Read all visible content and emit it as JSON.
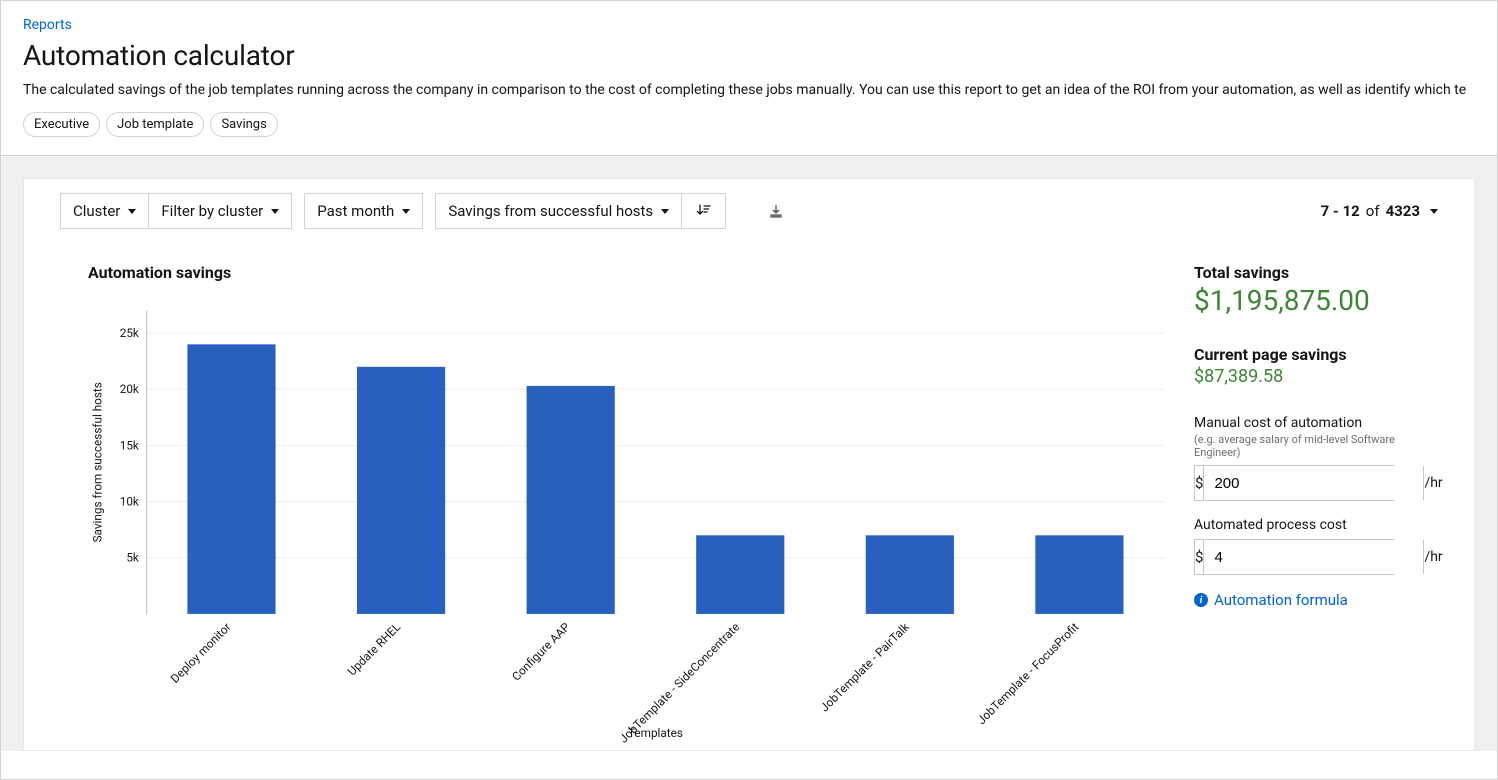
{
  "breadcrumb": {
    "reports": "Reports"
  },
  "page": {
    "title": "Automation calculator",
    "description": "The calculated savings of the job templates running across the company in comparison to the cost of completing these jobs manually. You can use this report to get an idea of the ROI from your automation, as well as identify which te"
  },
  "tags": [
    "Executive",
    "Job template",
    "Savings"
  ],
  "toolbar": {
    "cluster_label": "Cluster",
    "filter_label": "Filter by cluster",
    "date_label": "Past month",
    "metric_label": "Savings from successful hosts",
    "pagination": {
      "range": "7 - 12",
      "of": "of",
      "total": "4323"
    }
  },
  "chart": {
    "title": "Automation savings"
  },
  "sidebar": {
    "total_label": "Total savings",
    "total_value": "$1,195,875.00",
    "page_label": "Current page savings",
    "page_value": "$87,389.58",
    "manual_cost_label": "Manual cost of automation",
    "manual_cost_sublabel": "(e.g. average salary of mid-level Software Engineer)",
    "manual_cost_value": "200",
    "auto_cost_label": "Automated process cost",
    "auto_cost_value": "4",
    "currency": "$",
    "per_hr": "/hr",
    "formula_link": "Automation formula"
  },
  "chart_data": {
    "type": "bar",
    "title": "Automation savings",
    "xlabel": "Templates",
    "ylabel": "Savings from successful hosts",
    "ylim": [
      0,
      27000
    ],
    "yticks": [
      5000,
      10000,
      15000,
      20000,
      25000
    ],
    "ytick_labels": [
      "5k",
      "10k",
      "15k",
      "20k",
      "25k"
    ],
    "categories": [
      "Deploy monitor",
      "Update RHEL",
      "Configure AAP",
      "JobTemplate - SideConcentrate",
      "JobTemplate - PairTalk",
      "JobTemplate - FocusProfit"
    ],
    "values": [
      24000,
      22000,
      20300,
      7000,
      7000,
      7000
    ]
  }
}
